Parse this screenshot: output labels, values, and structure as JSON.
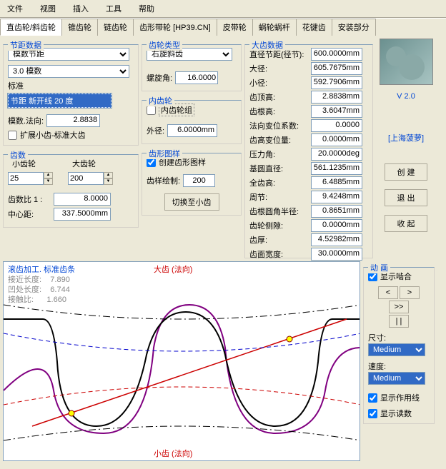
{
  "menu": [
    "文件",
    "视图",
    "插入",
    "工具",
    "帮助"
  ],
  "tabs": [
    "直齿轮/斜齿轮",
    "锥齿轮",
    "链齿轮",
    "齿形带轮 [HP39.CN]",
    "皮带轮",
    "蜗轮蜗杆",
    "花键齿",
    "安装部分"
  ],
  "active_tab": 0,
  "pitch": {
    "title": "节距数据",
    "type_sel": "模数节距",
    "mod_sel": "3.0 模数",
    "std_label": "标准",
    "std_sel": "节距 新开线 20 度",
    "mod_norm_label": "模数.法向:",
    "mod_norm": "2.8838",
    "extend_label": "扩展小齿-标准大齿"
  },
  "teeth": {
    "title": "齿数",
    "small_label": "小齿轮",
    "big_label": "大齿轮",
    "small": "25",
    "big": "200",
    "ratio_label": "齿数比 1 :",
    "ratio": "8.0000",
    "center_label": "中心距:",
    "center": "337.5000mm"
  },
  "gear_type": {
    "title": "齿轮类型",
    "sel": "右旋斜齿",
    "helix_label": "螺旋角:",
    "helix": "16.0000"
  },
  "internal": {
    "title": "内齿轮",
    "cb_label": "内齿轮组",
    "od_label": "外径:",
    "od": "6.0000mm"
  },
  "pattern": {
    "title": "齿形图样",
    "create_label": "创建齿形图样",
    "draw_label": "齿样绘制:",
    "draw_val": "200",
    "switch_btn": "切换至小齿"
  },
  "big_gear": {
    "title": "大齿数据",
    "labels": [
      "直径节距(径节):",
      "大径:",
      "小径:",
      "齿顶高:",
      "齿根高:",
      "法向变位系数:",
      "齿高变位量:",
      "压力角:",
      "基圆直径:",
      "全齿高:",
      "周节:",
      "齿根圆角半径:",
      "齿轮侧隙:",
      "齿厚:",
      "齿面宽度:"
    ],
    "vals": [
      "600.0000mm",
      "605.7675mm",
      "592.7906mm",
      "2.8838mm",
      "3.6047mm",
      "0.0000",
      "0.0000mm",
      "20.0000deg",
      "561.1235mm",
      "6.4885mm",
      "9.4248mm",
      "0.8651mm",
      "0.0000mm",
      "4.52982mm",
      "30.0000mm"
    ]
  },
  "version": "V 2.0",
  "brand": "[上海菠萝]",
  "btns": {
    "create": "创 建",
    "exit": "退 出",
    "collapse": "收 起"
  },
  "anim": {
    "title": "动 画",
    "mesh_label": "显示啮合",
    "size_label": "尺寸:",
    "size_sel": "Medium",
    "speed_label": "速度:",
    "speed_sel": "Medium",
    "action_label": "显示作用线",
    "count_label": "显示读数"
  },
  "chart": {
    "title": "滚齿加工. 标准齿条",
    "approach_label": "接近长度:",
    "approach": "7.890",
    "recess_label": "凹处长度:",
    "recess": "6.744",
    "contact_label": "接触比:",
    "contact": "1.660",
    "top_label": "大齿 (法向)",
    "bottom_label": "小齿 (法向)"
  },
  "chart_data": {
    "type": "line",
    "note": "Gear tooth profile mesh diagram — decorative profile curves, not a quantitative chart. No numeric axes present.",
    "series": [
      {
        "name": "big-gear-profile",
        "color": "#000"
      },
      {
        "name": "small-gear-profile",
        "color": "#800080"
      },
      {
        "name": "line-of-action",
        "color": "#c00"
      },
      {
        "name": "pitch-circle-big",
        "color": "#00c",
        "style": "dash"
      },
      {
        "name": "pitch-circle-small",
        "color": "#c00",
        "style": "dash"
      }
    ]
  }
}
